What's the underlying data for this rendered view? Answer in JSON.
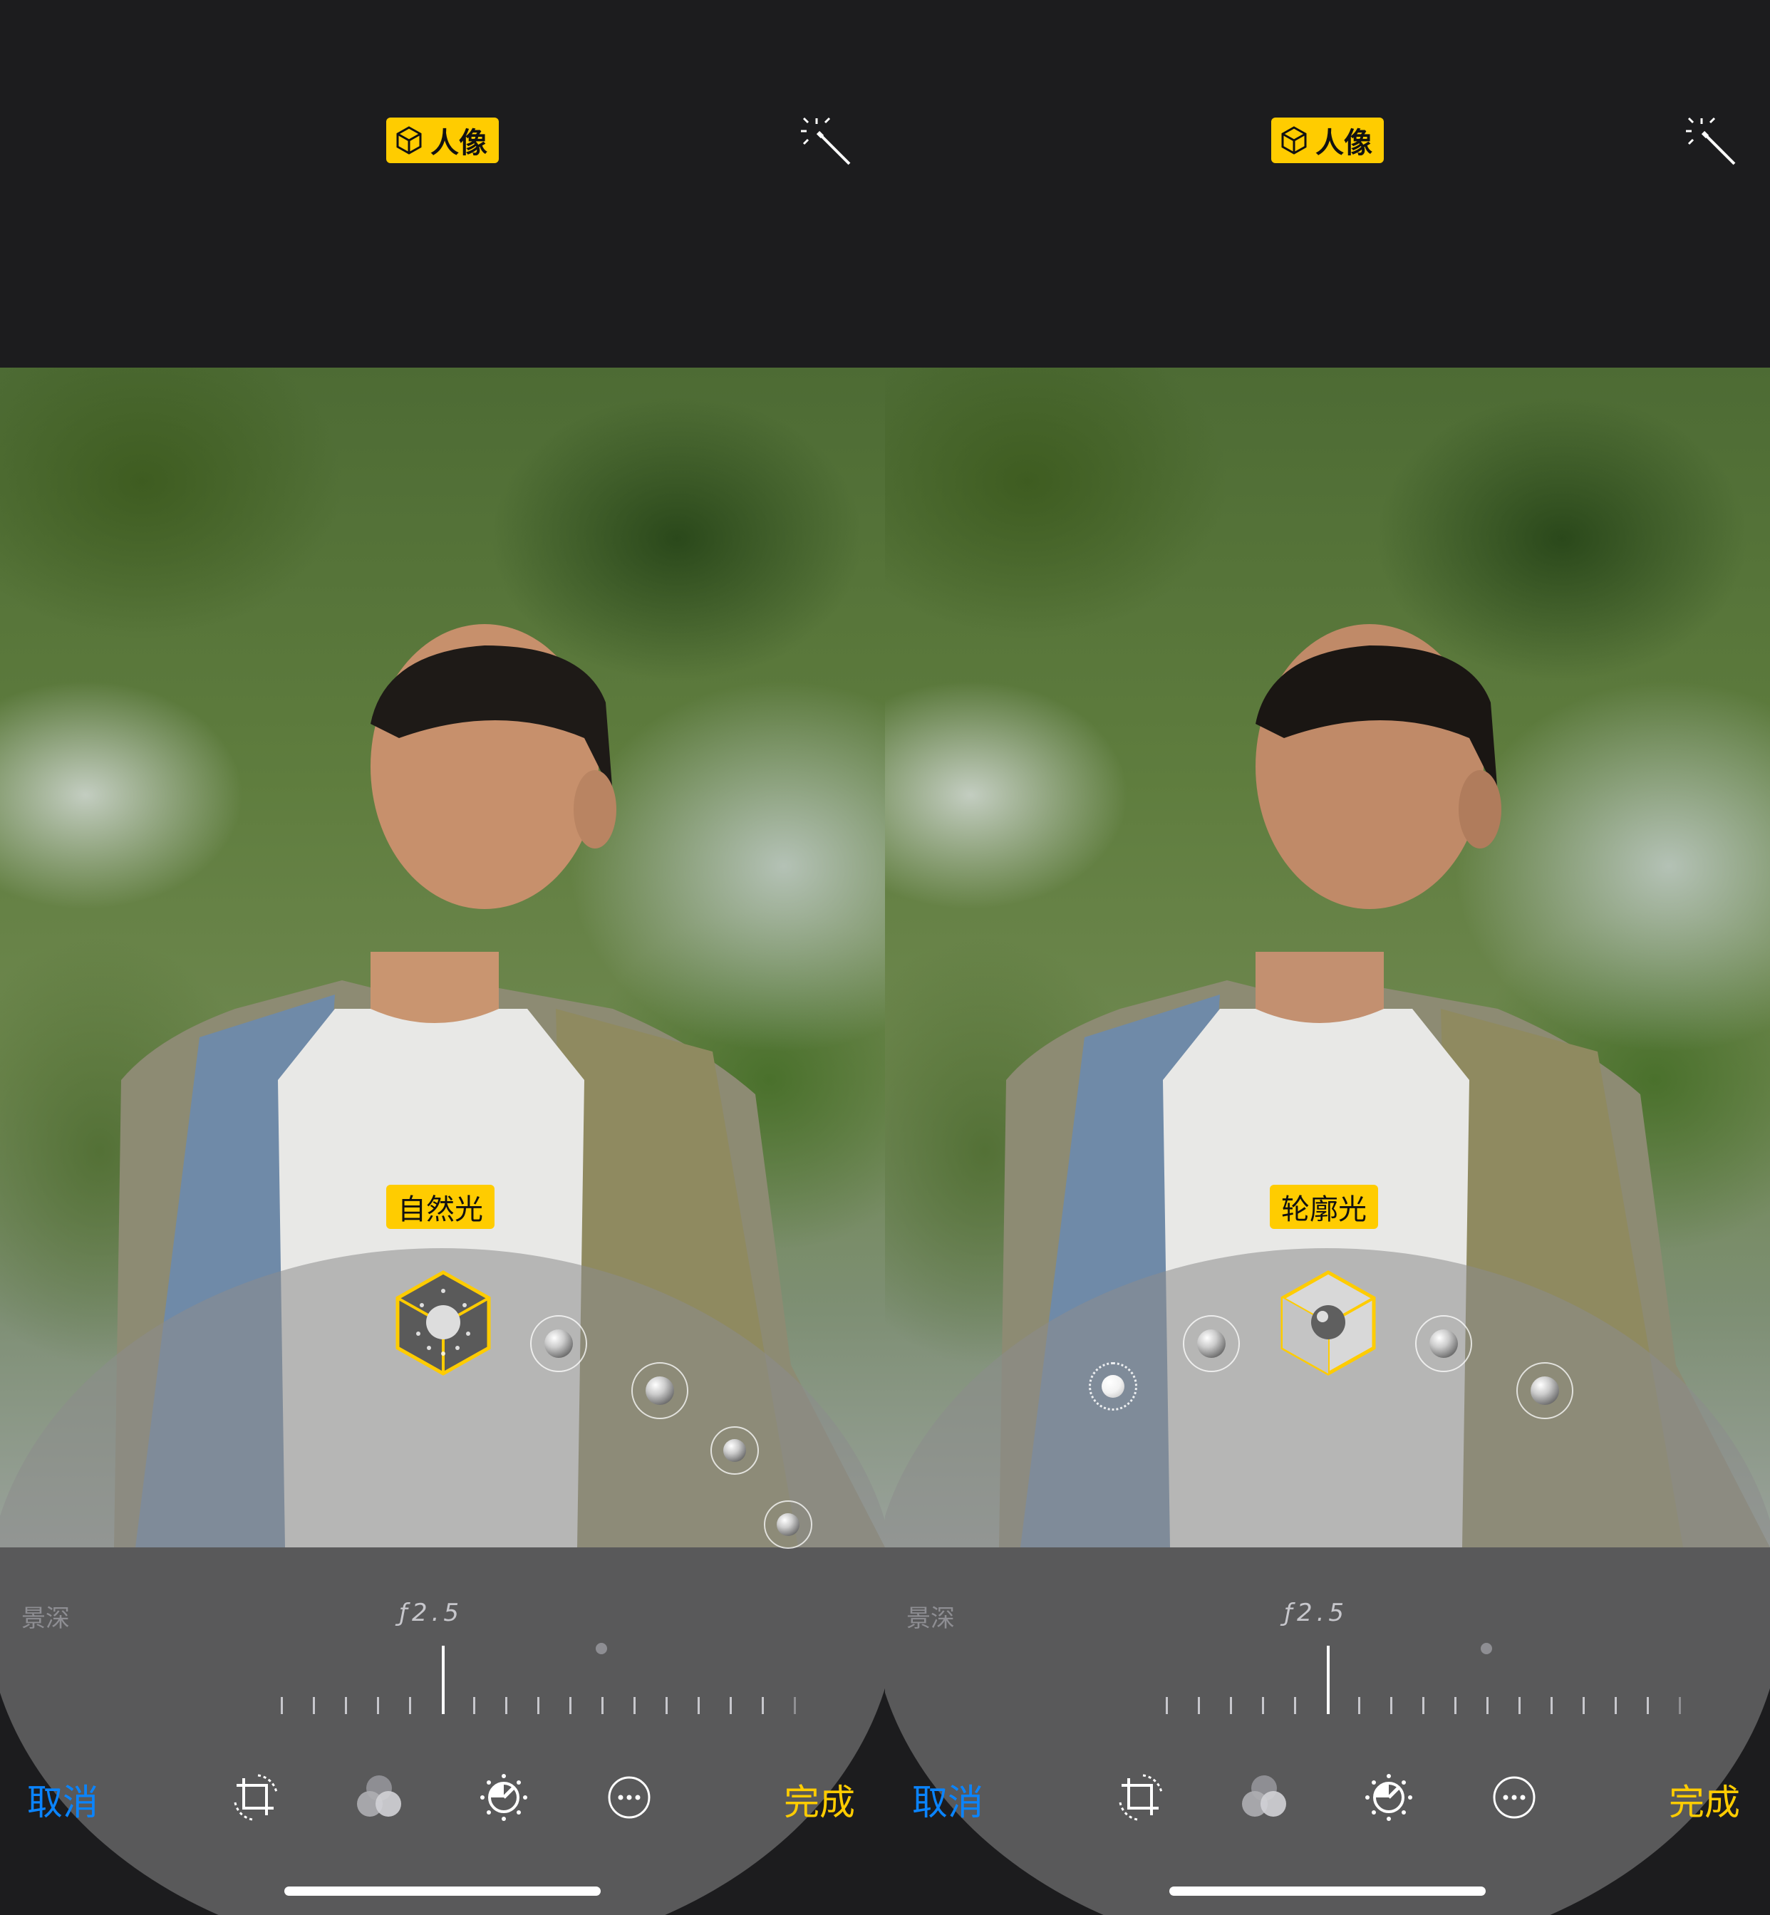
{
  "panels": [
    {
      "id": "natural",
      "badge_label": "人像",
      "lighting_label": "自然光",
      "depth_label": "景深",
      "depth_value": "ƒ2.5",
      "cancel_label": "取消",
      "done_label": "完成"
    },
    {
      "id": "contour",
      "badge_label": "人像",
      "lighting_label": "轮廓光",
      "depth_label": "景深",
      "depth_value": "ƒ2.5",
      "cancel_label": "取消",
      "done_label": "完成"
    }
  ],
  "colors": {
    "accent": "#ffcc00",
    "link": "#0a84ff",
    "background": "#1c1c1e"
  },
  "icons": [
    "portrait-cube-icon",
    "magic-wand-icon",
    "crop-rotate-icon",
    "filters-icon",
    "adjust-dial-icon",
    "more-icon",
    "lighting-cube-icon"
  ]
}
